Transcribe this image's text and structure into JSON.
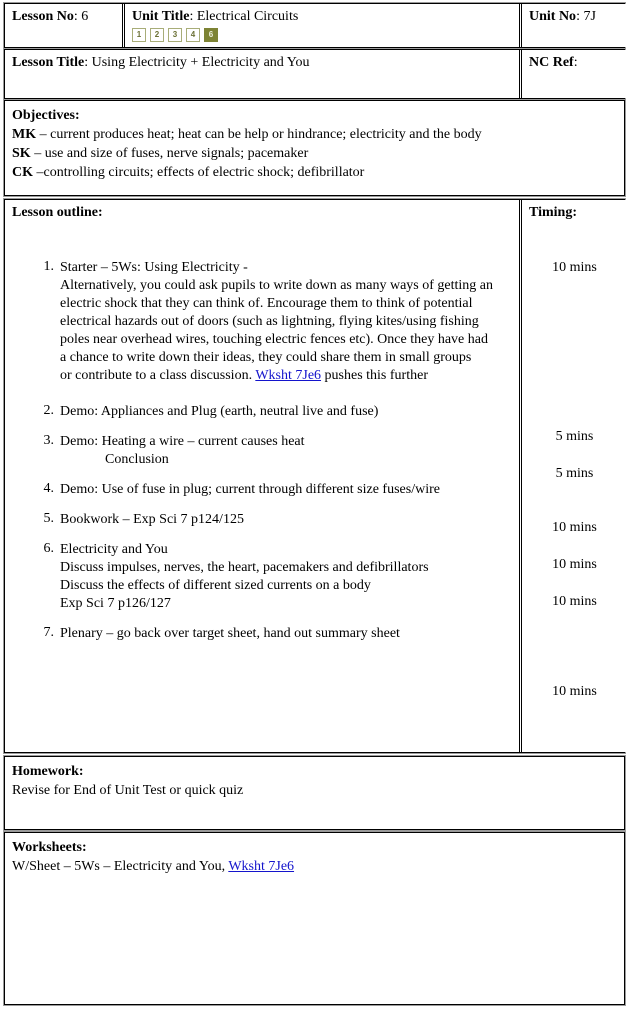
{
  "header": {
    "lesson_no_label": "Lesson No",
    "lesson_no_value": ": 6",
    "unit_title_label": "Unit Title",
    "unit_title_value": ": Electrical Circuits",
    "unit_no_label": "Unit No",
    "unit_no_value": ": 7J",
    "lesson_title_label": "Lesson Title",
    "lesson_title_value": ": Using Electricity + Electricity and You",
    "nc_ref_label": "NC Ref",
    "nc_ref_value": ":",
    "lesson_boxes": [
      {
        "n": "1",
        "active": false
      },
      {
        "n": "2",
        "active": false
      },
      {
        "n": "3",
        "active": false
      },
      {
        "n": "4",
        "active": false
      },
      {
        "n": "6",
        "active": true
      }
    ],
    "active_box_color": "#7d8334",
    "inactive_box_border": "#a8ad78"
  },
  "objectives": {
    "heading": "Objectives:",
    "lines": [
      {
        "code": "MK",
        "text": " – current produces heat; heat can be help or hindrance; electricity and the body"
      },
      {
        "code": "SK",
        "text": " – use and size of fuses, nerve signals; pacemaker"
      },
      {
        "code": "CK",
        "text": " –controlling circuits; effects of electric shock; defibrillator"
      }
    ]
  },
  "outline": {
    "heading": "Lesson outline:",
    "timing_heading": "Timing:",
    "items": [
      {
        "num": "1.",
        "lines": [
          {
            "text": "Starter – 5Ws: Using Electricity -"
          },
          {
            "text": "Alternatively, you could ask pupils to write down as many ways of getting an"
          },
          {
            "text": "electric shock that they can think of. Encourage them to think of potential"
          },
          {
            "text": "electrical hazards out of doors (such as lightning, flying kites/using fishing"
          },
          {
            "text": "poles near overhead wires, touching electric fences etc). Once they have had"
          },
          {
            "text": "a chance to write down their ideas, they could share them in small groups"
          },
          {
            "pre": "or contribute to a class discussion. ",
            "link": "Wksht 7Je6",
            "post": " pushes this further"
          }
        ]
      },
      {
        "num": "2.",
        "lines": [
          {
            "text": "Demo: Appliances and Plug (earth, neutral live and fuse)"
          }
        ]
      },
      {
        "num": "3.",
        "lines": [
          {
            "text": "Demo: Heating a wire – current causes heat"
          },
          {
            "text": "Conclusion",
            "indent": true
          }
        ]
      },
      {
        "num": "4.",
        "lines": [
          {
            "text": "Demo: Use of fuse in plug; current through different size fuses/wire"
          }
        ]
      },
      {
        "num": "5.",
        "lines": [
          {
            "text": "Bookwork – Exp Sci 7 p124/125"
          }
        ]
      },
      {
        "num": "6.",
        "lines": [
          {
            "text": "Electricity and You"
          },
          {
            "text": "Discuss impulses, nerves, the heart, pacemakers and defibrillators"
          },
          {
            "text": "Discuss the effects of different sized currents on a body"
          },
          {
            "text": "Exp Sci 7 p126/127"
          }
        ]
      },
      {
        "num": "7.",
        "lines": [
          {
            "text": "Plenary – go back over target sheet, hand out summary sheet"
          }
        ]
      }
    ],
    "timings": [
      {
        "value": "10 mins",
        "top": "60"
      },
      {
        "value": "5 mins",
        "top": "229"
      },
      {
        "value": "5 mins",
        "top": "266"
      },
      {
        "value": "10 mins",
        "top": "320"
      },
      {
        "value": "10 mins",
        "top": "357"
      },
      {
        "value": "10 mins",
        "top": "394"
      },
      {
        "value": "10 mins",
        "top": "484"
      }
    ]
  },
  "homework": {
    "heading": "Homework:",
    "text": "Revise for End of Unit Test or quick quiz"
  },
  "worksheets": {
    "heading": "Worksheets:",
    "text_pre": "W/Sheet – 5Ws – Electricity and You,  ",
    "link": "Wksht 7Je6"
  },
  "colors": {
    "link": "#1414cc",
    "border": "#000000",
    "outer_border": "#9a9a9a"
  }
}
